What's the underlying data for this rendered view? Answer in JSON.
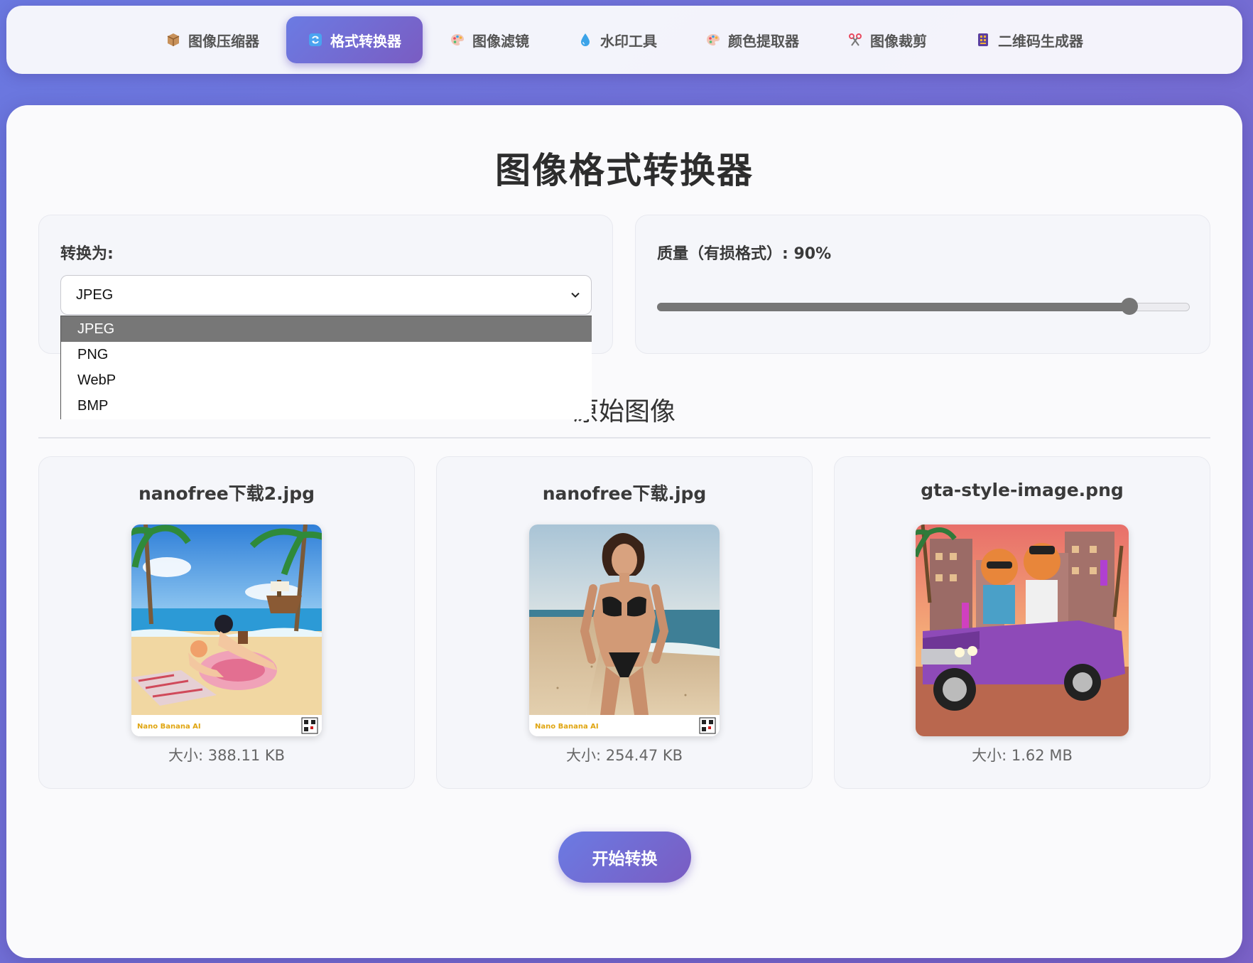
{
  "nav": {
    "items": [
      {
        "label": "图像压缩器",
        "icon": "package-icon",
        "active": false
      },
      {
        "label": "格式转换器",
        "icon": "refresh-icon",
        "active": true
      },
      {
        "label": "图像滤镜",
        "icon": "palette-icon",
        "active": false
      },
      {
        "label": "水印工具",
        "icon": "droplet-icon",
        "active": false
      },
      {
        "label": "颜色提取器",
        "icon": "palette-icon",
        "active": false
      },
      {
        "label": "图像裁剪",
        "icon": "scissors-icon",
        "active": false
      },
      {
        "label": "二维码生成器",
        "icon": "qr-book-icon",
        "active": false
      }
    ]
  },
  "page": {
    "title": "图像格式转换器"
  },
  "format": {
    "label": "转换为:",
    "selected": "JPEG",
    "options": [
      "JPEG",
      "PNG",
      "WebP",
      "BMP"
    ]
  },
  "quality": {
    "label": "质量（有损格式）: 90%",
    "value_percent": 90
  },
  "originals": {
    "title": "原始图像",
    "images": [
      {
        "name": "nanofree下载2.jpg",
        "size": "大小: 388.11 KB",
        "watermark": "Nano Banana AI"
      },
      {
        "name": "nanofree下载.jpg",
        "size": "大小: 254.47 KB",
        "watermark": "Nano Banana AI"
      },
      {
        "name": "gta-style-image.png",
        "size": "大小: 1.62 MB"
      }
    ]
  },
  "actions": {
    "convert_label": "开始转换"
  },
  "colors": {
    "accent_start": "#6b7be3",
    "accent_end": "#7a5cc2",
    "slider": "#767676"
  }
}
